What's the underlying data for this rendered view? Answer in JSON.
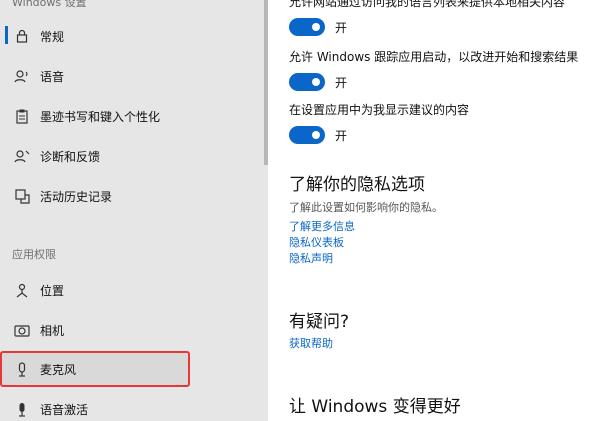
{
  "sidebar": {
    "title": "Windows 设置",
    "items_top": [
      {
        "label": "常规",
        "icon": "lock-icon"
      },
      {
        "label": "语音",
        "icon": "speech-icon"
      },
      {
        "label": "墨迹书写和键入个性化",
        "icon": "clipboard-icon"
      },
      {
        "label": "诊断和反馈",
        "icon": "feedback-icon"
      },
      {
        "label": "活动历史记录",
        "icon": "history-icon"
      }
    ],
    "section_apps": "应用权限",
    "items_apps": [
      {
        "label": "位置",
        "icon": "location-icon"
      },
      {
        "label": "相机",
        "icon": "camera-icon"
      },
      {
        "label": "麦克风",
        "icon": "microphone-icon"
      },
      {
        "label": "语音激活",
        "icon": "voice-activation-icon"
      }
    ]
  },
  "main": {
    "settings": [
      {
        "desc": "允许网站通过访问我的语言列表来提供本地相关内容",
        "state": "开"
      },
      {
        "desc": "允许 Windows 跟踪应用启动，以改进开始和搜索结果",
        "state": "开"
      },
      {
        "desc": "在设置应用中为我显示建议的内容",
        "state": "开"
      }
    ],
    "privacy_heading": "了解你的隐私选项",
    "privacy_sub": "了解此设置如何影响你的隐私。",
    "privacy_links": [
      "了解更多信息",
      "隐私仪表板",
      "隐私声明"
    ],
    "question_heading": "有疑问?",
    "help_link": "获取帮助",
    "improve_heading": "让 Windows 变得更好"
  }
}
